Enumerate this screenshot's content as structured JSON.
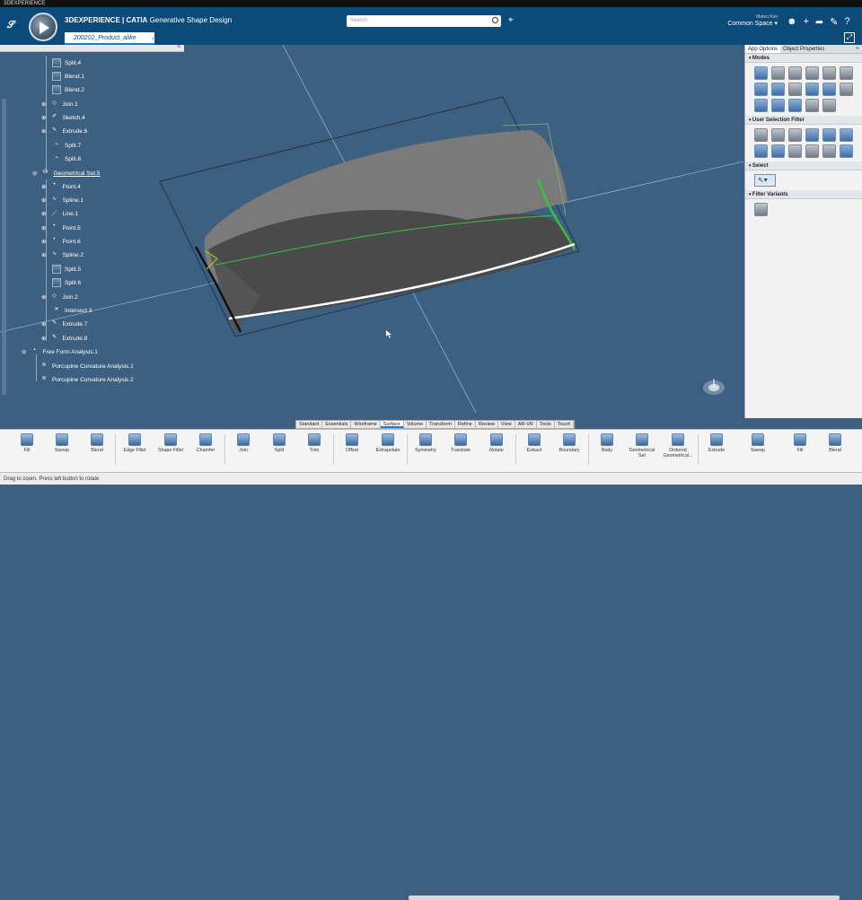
{
  "window_title": "3DEXPERIENCE",
  "app": {
    "brand": "3DEXPERIENCE | ",
    "product": "CATIA",
    "workbench": "Generative Shape Design"
  },
  "document_tab": "200202_Product_alike",
  "search": {
    "placeholder": "Search"
  },
  "user": {
    "name": "Mateu Kim",
    "space": "Common Space"
  },
  "tree": {
    "items": [
      {
        "label": "Split.4",
        "icon": "split-icon"
      },
      {
        "label": "Blend.1",
        "icon": "blend-icon"
      },
      {
        "label": "Blend.2",
        "icon": "blend-icon"
      },
      {
        "label": "Join.1",
        "icon": "join-icon"
      },
      {
        "label": "Sketch.4",
        "icon": "sketch-icon"
      },
      {
        "label": "Extrude.6",
        "icon": "extrude-icon"
      },
      {
        "label": "Split.7",
        "icon": "split-icon"
      },
      {
        "label": "Split.8",
        "icon": "split-icon"
      },
      {
        "label": "Geometrical Set.5",
        "icon": "geometrical-set-icon"
      },
      {
        "label": "Point.4",
        "icon": "point-icon"
      },
      {
        "label": "Spline.1",
        "icon": "spline-icon"
      },
      {
        "label": "Line.1",
        "icon": "line-icon"
      },
      {
        "label": "Point.5",
        "icon": "point-icon"
      },
      {
        "label": "Point.6",
        "icon": "point-icon"
      },
      {
        "label": "Spline.2",
        "icon": "spline-icon"
      },
      {
        "label": "Split.5",
        "icon": "split-icon"
      },
      {
        "label": "Split.6",
        "icon": "split-icon"
      },
      {
        "label": "Join.2",
        "icon": "join-icon"
      },
      {
        "label": "Intersect.3",
        "icon": "intersect-icon"
      },
      {
        "label": "Extrude.7",
        "icon": "extrude-icon"
      },
      {
        "label": "Extrude.8",
        "icon": "extrude-icon"
      },
      {
        "label": "Free Form Analysis.1",
        "icon": "analysis-icon"
      },
      {
        "label": "Porcupine Curvature Analysis.1",
        "icon": "curvature-analysis-icon"
      },
      {
        "label": "Porcupine Curvature Analysis.2",
        "icon": "curvature-analysis-icon"
      }
    ]
  },
  "right_panel": {
    "tabs": [
      "App Options",
      "Object Properties"
    ],
    "sections": {
      "modes": "Modes",
      "user_selection_filter": "User Selection Filter",
      "select": "Select",
      "filter_variants": "Filter Variants"
    }
  },
  "section_tabs": [
    "Standard",
    "Essentials",
    "Wireframe",
    "Surface",
    "Volume",
    "Transform",
    "Refine",
    "Review",
    "View",
    "AR-VR",
    "Tools",
    "Touch"
  ],
  "active_section": "Surface",
  "actions": [
    {
      "label": "Fill",
      "icon": "fill-icon"
    },
    {
      "label": "Sweep",
      "icon": "sweep-icon"
    },
    {
      "label": "Blend",
      "icon": "blend-icon"
    },
    {
      "label": "Edge Fillet",
      "icon": "edge-fillet-icon"
    },
    {
      "label": "Shape Fillet",
      "icon": "shape-fillet-icon"
    },
    {
      "label": "Chamfer",
      "icon": "chamfer-icon"
    },
    {
      "label": "Join",
      "icon": "join-icon"
    },
    {
      "label": "Split",
      "icon": "split-icon"
    },
    {
      "label": "Trim",
      "icon": "trim-icon"
    },
    {
      "label": "Offset",
      "icon": "offset-icon"
    },
    {
      "label": "Extrapolate",
      "icon": "extrapolate-icon"
    },
    {
      "label": "Symmetry",
      "icon": "symmetry-icon"
    },
    {
      "label": "Translate",
      "icon": "translate-icon"
    },
    {
      "label": "Rotate",
      "icon": "rotate-icon"
    },
    {
      "label": "Extract",
      "icon": "extract-icon"
    },
    {
      "label": "Boundary",
      "icon": "boundary-icon"
    },
    {
      "label": "Body",
      "icon": "body-icon"
    },
    {
      "label": "Geometrical Set",
      "icon": "geometrical-set-icon"
    },
    {
      "label": "Ordered Geometrical...",
      "icon": "ordered-geometrical-set-icon"
    },
    {
      "label": "Extrude",
      "icon": "extrude-icon"
    },
    {
      "label": "Sweep",
      "icon": "sweep-icon"
    },
    {
      "label": "Fill",
      "icon": "fill-icon"
    },
    {
      "label": "Blend",
      "icon": "blend-icon"
    }
  ],
  "status": "Drag to zoom. Press left button to rotate",
  "colors": {
    "topbar": "#0c4a7a",
    "viewport": "#3d5f80",
    "accent": "#1a7bd0",
    "surface": "#6e6e6e",
    "curvature_green": "#3cc03c"
  }
}
